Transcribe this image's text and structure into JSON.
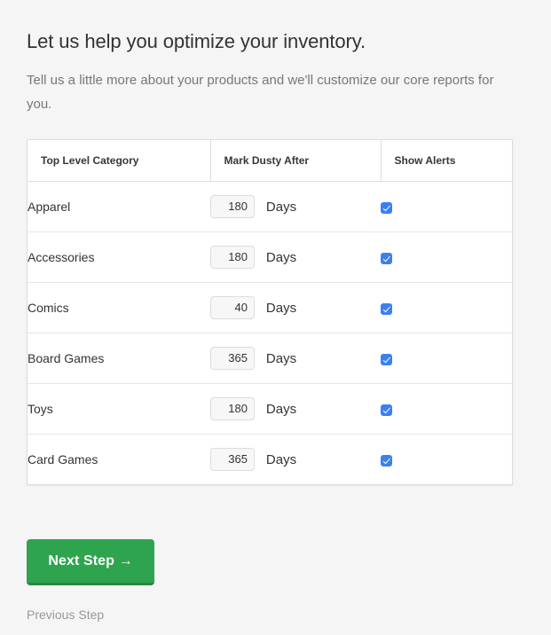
{
  "header": {
    "title": "Let us help you optimize your inventory.",
    "subtitle": "Tell us a little more about your products and we'll customize our core reports for you."
  },
  "table": {
    "columns": {
      "category": "Top Level Category",
      "dusty": "Mark Dusty After",
      "alerts": "Show Alerts"
    },
    "days_label": "Days",
    "rows": [
      {
        "category": "Apparel",
        "days": "180",
        "alerts_checked": true
      },
      {
        "category": "Accessories",
        "days": "180",
        "alerts_checked": true
      },
      {
        "category": "Comics",
        "days": "40",
        "alerts_checked": true
      },
      {
        "category": "Board Games",
        "days": "365",
        "alerts_checked": true
      },
      {
        "category": "Toys",
        "days": "180",
        "alerts_checked": true
      },
      {
        "category": "Card Games",
        "days": "365",
        "alerts_checked": true
      }
    ]
  },
  "actions": {
    "next_label": "Next Step →",
    "previous_label": "Previous Step"
  },
  "colors": {
    "page_background": "#f5f5f5",
    "accent_green": "#2fa44f",
    "checkbox_blue": "#3b7ff5",
    "text_primary": "#333333",
    "text_muted": "#777777",
    "link_muted": "#999999"
  }
}
